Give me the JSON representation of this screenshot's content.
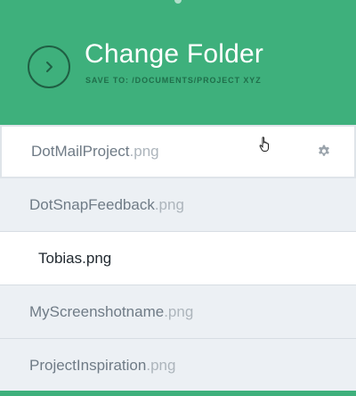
{
  "header": {
    "title": "Change Folder",
    "subtitle": "SAVE TO: /DOCUMENTS/PROJECT XYZ",
    "nav_icon": "chevron-right-icon",
    "accent": "#3eb07c"
  },
  "files": [
    {
      "base": "DotMailProject",
      "ext": ".png",
      "state": "selected"
    },
    {
      "base": "DotSnapFeedback",
      "ext": ".png",
      "state": "normal"
    },
    {
      "base": "Tobias",
      "ext": ".png",
      "state": "hover"
    },
    {
      "base": "MyScreenshotname",
      "ext": ".png",
      "state": "normal"
    },
    {
      "base": "ProjectInspiration",
      "ext": ".png",
      "state": "normal"
    }
  ]
}
